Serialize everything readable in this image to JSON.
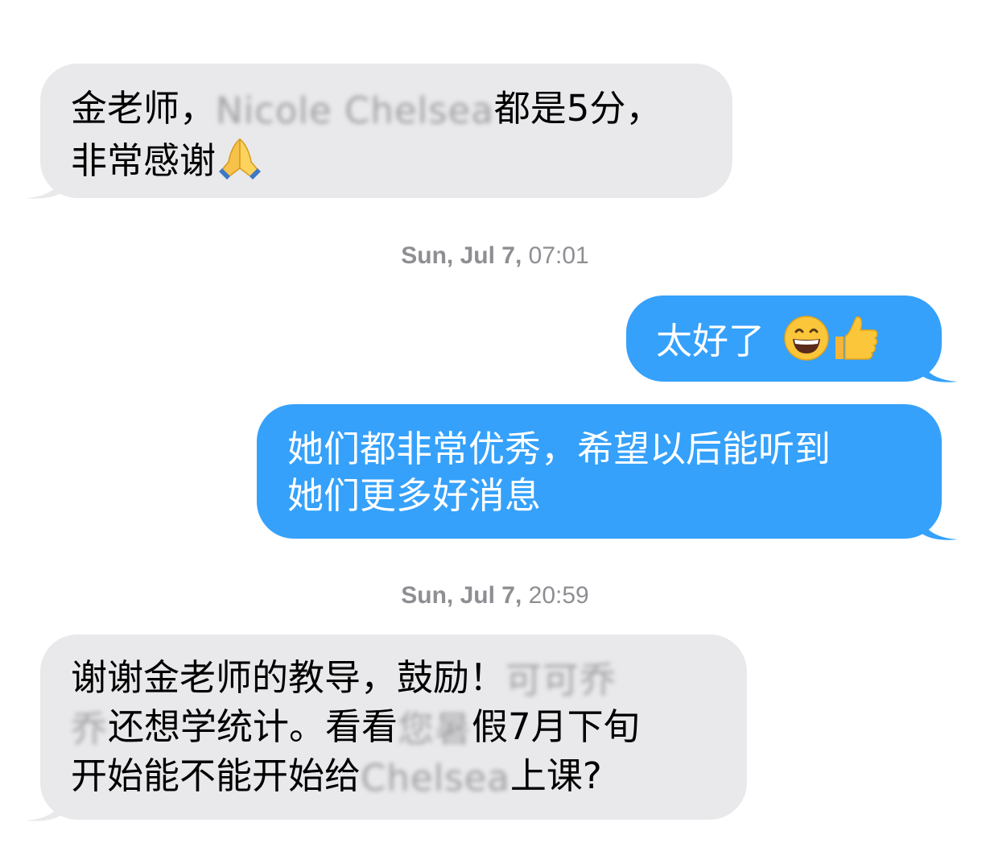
{
  "thread": {
    "messages": [
      {
        "direction": "received",
        "lines": [
          {
            "prefix": "金老师，",
            "blurred": "Nicole Chelsea",
            "suffix": "都是5分，"
          },
          {
            "text": "非常感谢",
            "emoji": "folded-hands-icon"
          }
        ]
      },
      {
        "direction": "sent",
        "text": "太好了",
        "emojis": [
          "grinning-face-icon",
          "thumbs-up-icon"
        ]
      },
      {
        "direction": "sent",
        "lines": [
          "她们都非常优秀，希望以后能听到",
          "她们更多好消息"
        ]
      },
      {
        "direction": "received",
        "lines": [
          {
            "prefix": "谢谢金老师的教导，鼓励！",
            "blurred": "可可乔"
          },
          {
            "blurred": "乔",
            "suffix_a": "还想学统计。看看",
            "blurred2": "您暑",
            "suffix_b": "假7月下旬"
          },
          {
            "prefix": "开始能不能开始给",
            "blurred": "Chelsea",
            "suffix": "上课?"
          }
        ]
      }
    ],
    "timestamps": [
      {
        "day": "Sun, Jul 7,",
        "time": "07:01"
      },
      {
        "day": "Sun, Jul 7,",
        "time": "20:59"
      }
    ]
  },
  "colors": {
    "sent_bubble": "#35a1fb",
    "received_bubble": "#e9e9eb",
    "timestamp": "#8e8e93"
  }
}
